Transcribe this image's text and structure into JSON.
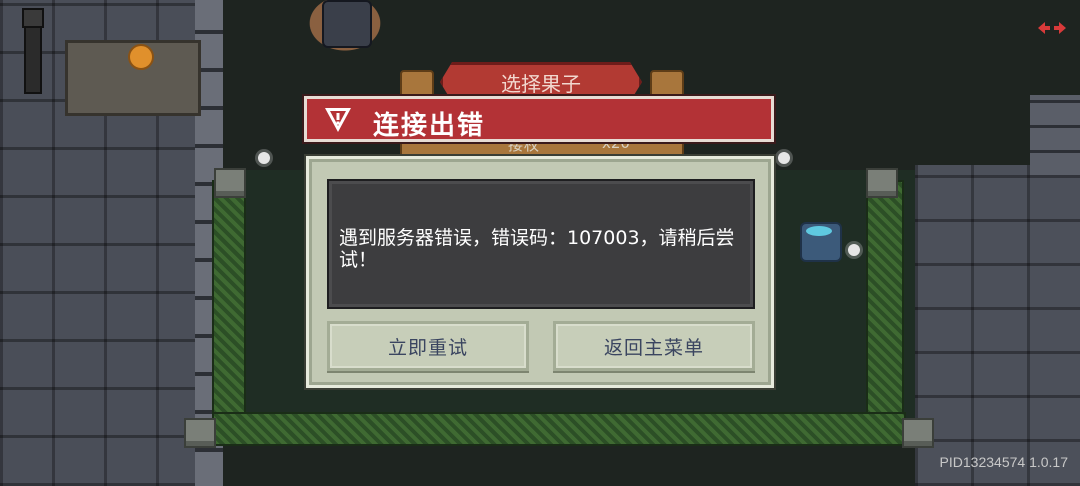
{
  "background": {
    "plaque_title": "选择果子",
    "behind_row_text": "接权",
    "behind_row_count": "x20"
  },
  "dialog": {
    "title": "连接出错",
    "title_icon": "warning-icon",
    "message": "遇到服务器错误，错误码：107003，请稍后尝试！",
    "buttons": {
      "retry": "立即重试",
      "main_menu": "返回主菜单"
    }
  },
  "footer": {
    "version": "PID13234574 1.0.17"
  },
  "colors": {
    "header_red": "#b33236",
    "panel_dark": "#3d3d3f",
    "dialog_body": "#c2c9b4",
    "button_text": "#3a4560",
    "corner_icon": "#d83a3a"
  },
  "icons": {
    "corner": "swap-arrows-icon"
  }
}
